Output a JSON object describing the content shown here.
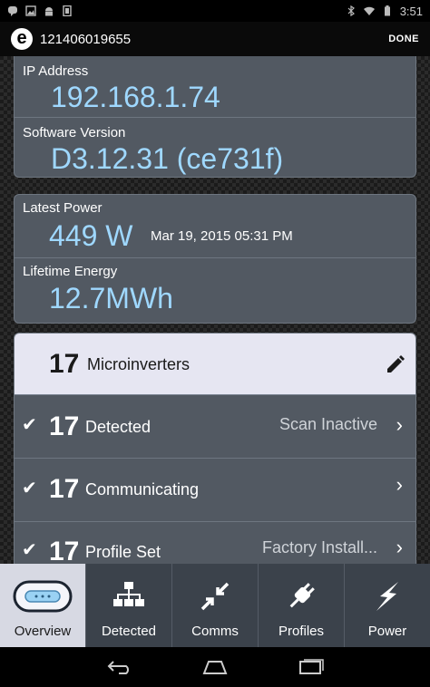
{
  "status_bar": {
    "time": "3:51",
    "left_icons": [
      "hangouts-icon",
      "image-icon",
      "android-icon",
      "sim-icon"
    ],
    "right_icons": [
      "bluetooth-icon",
      "wifi-icon",
      "battery-icon"
    ]
  },
  "action_bar": {
    "logo_letter": "e",
    "serial": "121406019655",
    "done_label": "DONE"
  },
  "network": {
    "ip_label": "IP Address",
    "ip_value": "192.168.1.74",
    "software_label": "Software Version",
    "software_value": "D3.12.31 (ce731f)"
  },
  "production": {
    "latest_power_label": "Latest Power",
    "latest_power_value": "449",
    "latest_power_unit": "W",
    "latest_power_date": "Mar 19, 2015 05:31 PM",
    "lifetime_label": "Lifetime Energy",
    "lifetime_value": "12.7",
    "lifetime_unit": "MWh"
  },
  "inverters": {
    "header_count": "17",
    "header_label": "Microinverters",
    "rows": [
      {
        "count": "17",
        "label": "Detected",
        "status": "Scan Inactive"
      },
      {
        "count": "17",
        "label": "Communicating",
        "status": ""
      },
      {
        "count": "17",
        "label": "Profile Set",
        "status": "Factory Install..."
      }
    ]
  },
  "tabs": [
    {
      "label": "Overview",
      "icon": "envoy-device-icon",
      "active": true
    },
    {
      "label": "Detected",
      "icon": "network-tree-icon",
      "active": false
    },
    {
      "label": "Comms",
      "icon": "arrows-in-icon",
      "active": false
    },
    {
      "label": "Profiles",
      "icon": "plug-icon",
      "active": false
    },
    {
      "label": "Power",
      "icon": "lightning-icon",
      "active": false
    }
  ],
  "colors": {
    "accent_value": "#9fd8ff",
    "card_bg": "#525962",
    "header_row_bg": "#e6e6f2",
    "tab_active_bg": "#d7d9e3",
    "tabbar_bg": "#3b424b"
  }
}
